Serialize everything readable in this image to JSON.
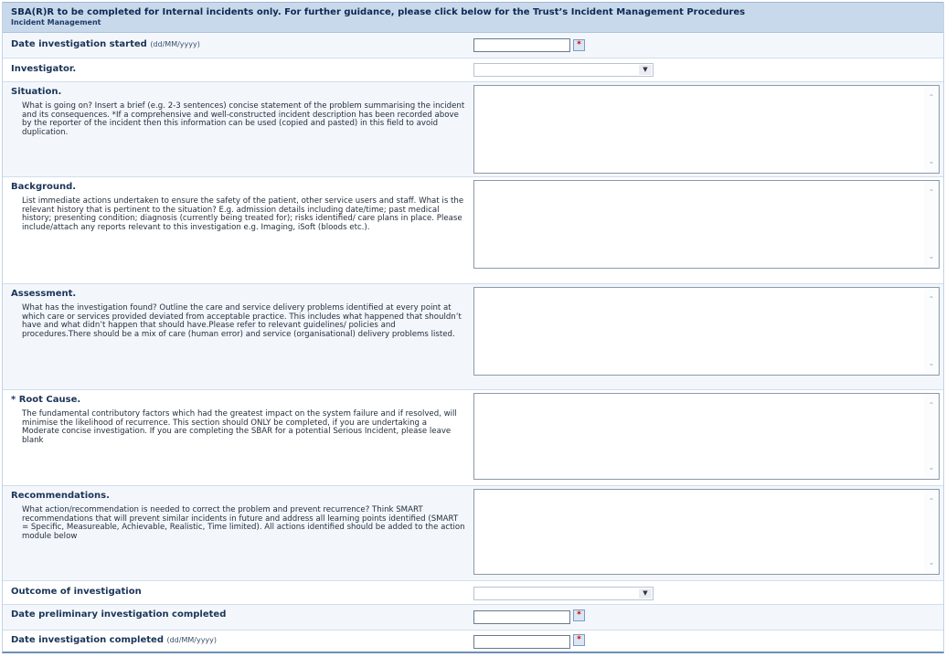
{
  "header": {
    "title": "SBA(R)R to be completed for Internal incidents only. For further guidance, please click below for the Trust’s Incident Management Procedures",
    "subtitle": "Incident Management"
  },
  "fields": {
    "date_started": {
      "label": "Date investigation started",
      "format": "(dd/MM/yyyy)",
      "value": ""
    },
    "investigator": {
      "label": "Investigator.",
      "selected": ""
    },
    "situation": {
      "label": "Situation.",
      "help": "What is going on? Insert a brief (e.g. 2-3 sentences) concise statement of the problem summarising the incident and its consequences. *If a comprehensive and well-constructed incident description has been recorded above by the reporter of the incident then this information can be used (copied and pasted) in this field to avoid duplication.",
      "value": ""
    },
    "background": {
      "label": "Background.",
      "help": "List immediate actions undertaken to ensure the safety of the patient, other service users and staff. What is the relevant history that is pertinent to the situation? E.g. admission details including date/time; past medical history; presenting condition; diagnosis (currently being treated for); risks identified/ care plans in place. Please include/attach any reports relevant to this investigation e.g. Imaging, iSoft (bloods etc.).",
      "value": ""
    },
    "assessment": {
      "label": "Assessment.",
      "help": "What has the investigation found? Outline the care and service delivery problems identified at every point at which care or services provided deviated from acceptable practice. This includes what happened that shouldn’t have and what didn’t happen that should have.Please refer to relevant guidelines/ policies and procedures.There should be a mix of care (human error) and service (organisational) delivery problems listed.",
      "value": ""
    },
    "root_cause": {
      "label": "* Root Cause.",
      "help": "The fundamental contributory factors which had the greatest impact on the system failure and if resolved, will minimise the likelihood of recurrence. This section should ONLY be completed, if you are undertaking a Moderate concise investigation. If you are completing the SBAR for a potential Serious Incident, please leave blank",
      "value": ""
    },
    "recommendations": {
      "label": "Recommendations.",
      "help": "What action/recommendation is needed to correct the problem and prevent recurrence? Think SMART recommendations that will prevent similar incidents in future and address all learning points identified (SMART = Specific, Measureable, Achievable, Realistic, Time limited). All actions identified should be added to the action module below",
      "value": ""
    },
    "outcome": {
      "label": "Outcome of investigation",
      "selected": ""
    },
    "date_preliminary": {
      "label": "Date preliminary investigation completed",
      "value": ""
    },
    "date_completed": {
      "label": "Date investigation completed",
      "format": "(dd/MM/yyyy)",
      "value": ""
    }
  },
  "icons": {
    "required": "required-star-icon",
    "dropdown": "chevron-down-icon",
    "scroll_up": "scroll-up-icon",
    "scroll_down": "scroll-down-icon"
  },
  "colors": {
    "header_bg": "#c9d9ec",
    "label_text": "#1b3459",
    "required_marker": "#d10000"
  }
}
